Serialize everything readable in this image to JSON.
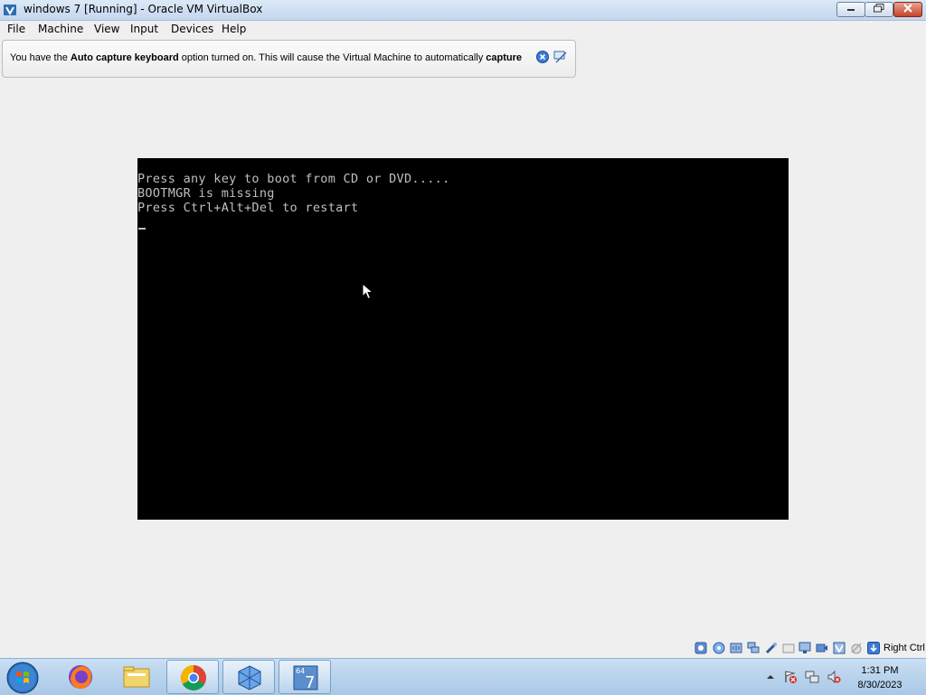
{
  "window": {
    "title": "windows 7 [Running] - Oracle VM VirtualBox",
    "icon": "virtualbox-icon",
    "controls": [
      "minimize",
      "restore",
      "close"
    ]
  },
  "menu": [
    "File",
    "Machine",
    "View",
    "Input",
    "Devices",
    "Help"
  ],
  "banner": {
    "text_1": "You have the ",
    "bold_1": "Auto capture keyboard",
    "text_2": " option turned on. This will cause the Virtual Machine to automatically ",
    "bold_2": "capture",
    "icons": [
      "close-message-icon",
      "hide-message-icon"
    ]
  },
  "console": {
    "lines": [
      "Press any key to boot from CD or DVD.....",
      "BOOTMGR is missing",
      "Press Ctrl+Alt+Del to restart"
    ],
    "background": "#000000",
    "text_color": "#bfbfbf"
  },
  "statusbar": {
    "icons": [
      "hard-disk-icon",
      "optical-drive-icon",
      "audio-icon",
      "network-icon",
      "usb-icon",
      "shared-folders-icon",
      "display-icon",
      "video-capture-icon",
      "virtualization-icon",
      "mouse-integration-icon",
      "host-key-arrow-icon"
    ],
    "host_key": "Right Ctrl"
  },
  "taskbar": {
    "apps": [
      "firefox-icon",
      "file-explorer-icon",
      "chrome-icon",
      "virtualbox-icon",
      "windows7-vm-icon"
    ],
    "tray_icons": [
      "show-hidden-icons-icon",
      "action-center-icon",
      "network-icon",
      "volume-muted-icon"
    ],
    "time": "1:31 PM",
    "date": "8/30/2023"
  }
}
